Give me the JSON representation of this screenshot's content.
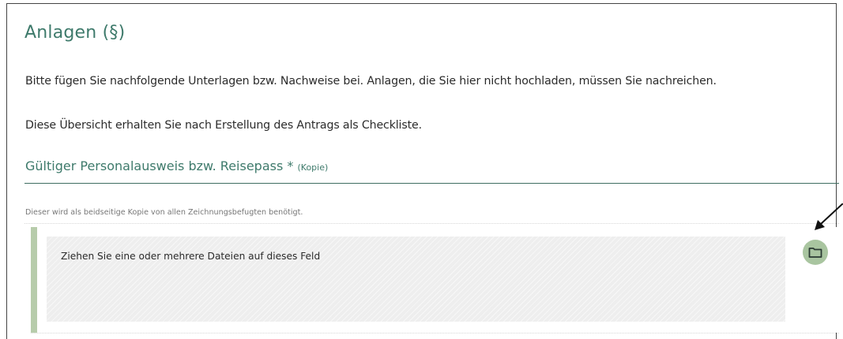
{
  "page": {
    "title": "Anlagen (§)",
    "intro_line_1": "Bitte fügen Sie nachfolgende Unterlagen bzw. Nachweise bei. Anlagen, die Sie hier nicht hochladen, müssen Sie nachreichen.",
    "intro_line_2": "Diese Übersicht erhalten Sie nach Erstellung des Antrags als Checkliste."
  },
  "document_section": {
    "heading": "Gültiger Personalausweis bzw. Reisepass *",
    "heading_note": "(Kopie)",
    "hint": "Dieser wird als beidseitige Kopie von allen Zeichnungsbefugten benötigt.",
    "dropzone_text": "Ziehen Sie eine oder mehrere Dateien auf dieses Feld",
    "folder_icon": "folder-icon"
  },
  "colors": {
    "accent": "#3e7a6b",
    "upload_bar": "#b7ccab",
    "folder_button": "#a9c5a0",
    "dropzone_bg": "#eeeeee",
    "pointer_arrow": "#111111"
  }
}
